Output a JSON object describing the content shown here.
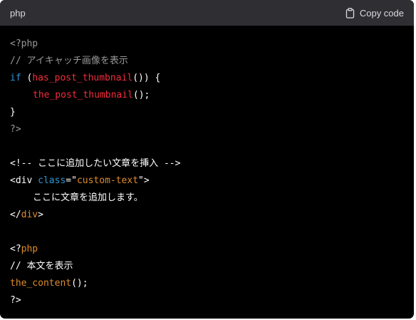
{
  "header": {
    "language": "php",
    "copy_label": "Copy code"
  },
  "code": {
    "l1": "<?php",
    "l2": "// アイキャッチ画像を表示",
    "l3_kw": "if",
    "l3_a": " (",
    "l3_fn": "has_post_thumbnail",
    "l3_b": "()) {",
    "l4_fn": "the_post_thumbnail",
    "l4_b": "();",
    "l5": "}",
    "l6": "?>",
    "l8": "<!-- ここに追加したい文章を挿入 -->",
    "l9_open": "<div ",
    "l9_attr": "class",
    "l9_eq": "=\"",
    "l9_val": "custom-text",
    "l9_close": "\">",
    "l10": "ここに文章を追加します。",
    "l11_a": "</",
    "l11_tag": "div",
    "l11_b": ">",
    "l13_a": "<?",
    "l13_b": "php",
    "l14": "// 本文を表示",
    "l15_fn": "the_content",
    "l15_b": "();",
    "l16": "?>"
  },
  "colors": {
    "background": "#000000",
    "header_background": "#2f2f33",
    "keyword": "#2e95d3",
    "function": "#f22c3d",
    "string": "#df8c2a",
    "comment": "#999999"
  },
  "icons": {
    "copy": "clipboard-icon"
  }
}
